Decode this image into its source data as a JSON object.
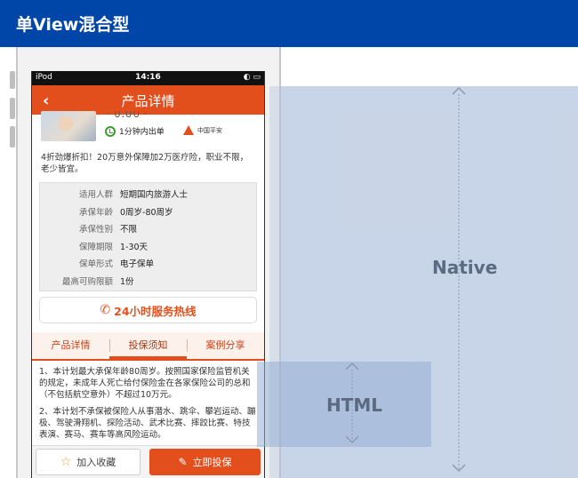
{
  "banner": {
    "title": "单View混合型"
  },
  "labels": {
    "native": "Native",
    "html": "HTML"
  },
  "phone": {
    "status": {
      "carrier": "iPod",
      "time": "14:16",
      "indicators": "◐ ▭"
    },
    "nav": {
      "back_icon": "‹",
      "title": "产品详情"
    },
    "hero": {
      "cutoff_text": "· ∪.∪∪ ·",
      "badge_time": "1分钟内出单",
      "badge_company": "中国平安"
    },
    "description": "4折劲爆折扣！20万意外保障加2万医疗险，职业不限，老少皆宜。",
    "info": [
      {
        "key": "适用人群",
        "value": "短期国内旅游人士"
      },
      {
        "key": "承保年龄",
        "value": "0周岁-80周岁"
      },
      {
        "key": "承保性别",
        "value": "不限"
      },
      {
        "key": "保障期限",
        "value": "1-30天"
      },
      {
        "key": "保单形式",
        "value": "电子保单"
      },
      {
        "key": "最高可购限额",
        "value": "1份"
      }
    ],
    "hotline": "24小时服务热线",
    "tabs": [
      "产品详情",
      "投保须知",
      "案例分享"
    ],
    "content": [
      "1、本计划最大承保年龄80周岁。按照国家保险监管机关的规定，未成年人死亡给付保险金在各家保险公司的总和（不包括航空意外）不超过10万元。",
      "2、本计划不承保被保险人从事潜水、跳伞、攀岩运动、蹦极、驾驶滑翔机、探险活动、武术比赛、摔跤比赛、特技表演、赛马、赛车等高风险运动。"
    ],
    "bottom": {
      "favorite": "加入收藏",
      "buy": "立即投保"
    }
  }
}
